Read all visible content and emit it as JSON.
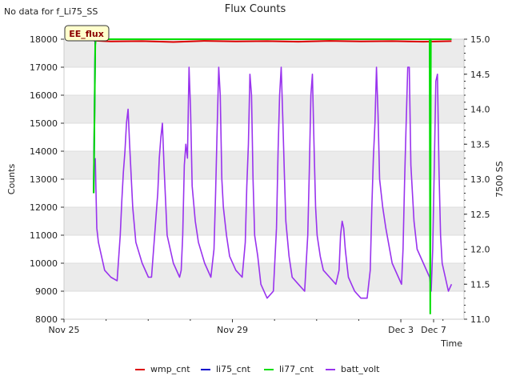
{
  "header": {
    "no_data_note": "No data for f_Li75_SS",
    "title": "Flux Counts",
    "badge": "EE_flux"
  },
  "colors": {
    "wmp_cnt": "#dd0000",
    "li75_cnt": "#0000cc",
    "li77_cnt": "#00dd00",
    "batt_volt": "#9933ee",
    "band": "#ebebeb",
    "badge_bg": "#ffffcc",
    "badge_text": "#8b0000"
  },
  "chart_data": {
    "type": "line",
    "title": "Flux Counts",
    "xlabel": "Time",
    "ylabel": "Counts",
    "y2label": "7500 SS",
    "xlim": [
      0,
      9.5
    ],
    "ylim": [
      8000,
      18000
    ],
    "y2lim": [
      11.0,
      15.0
    ],
    "x_ticks": [
      {
        "x": 0,
        "label": "Nov 25"
      },
      {
        "x": 4,
        "label": "Nov 29"
      },
      {
        "x": 8,
        "label": "Dec 3"
      },
      {
        "x": 12,
        "label": "Dec 7"
      }
    ],
    "y_ticks": [
      8000,
      9000,
      10000,
      11000,
      12000,
      13000,
      14000,
      15000,
      16000,
      17000,
      18000
    ],
    "y2_ticks": [
      "11.0",
      "11.5",
      "12.0",
      "12.5",
      "13.0",
      "13.5",
      "14.0",
      "14.5",
      "15.0"
    ],
    "grid": true,
    "legend_position": "bottom",
    "series": [
      {
        "name": "wmp_cnt",
        "axis": "left",
        "x": [
          0.95,
          1.5,
          2.5,
          3.5,
          4.5,
          5.5,
          6.5,
          7.5,
          8.5,
          9.5,
          10.5,
          11.5,
          12.4
        ],
        "y": [
          17950,
          17920,
          17930,
          17900,
          17940,
          17920,
          17930,
          17910,
          17940,
          17920,
          17930,
          17910,
          17930
        ]
      },
      {
        "name": "li75_cnt",
        "axis": "left",
        "x": [
          0.95,
          1.0,
          12.4
        ],
        "y": [
          12500,
          18000,
          18000
        ]
      },
      {
        "name": "li77_cnt",
        "axis": "left",
        "x": [
          0.95,
          1.0,
          1.02,
          11.7,
          11.72,
          11.74,
          11.76,
          12.4
        ],
        "y": [
          12500,
          17800,
          18000,
          18000,
          8200,
          18000,
          18000,
          18000
        ]
      },
      {
        "name": "batt_volt",
        "axis": "right",
        "x": [
          1.0,
          1.05,
          1.1,
          1.2,
          1.3,
          1.5,
          1.7,
          1.8,
          1.85,
          1.9,
          1.95,
          2.0,
          2.05,
          2.1,
          2.2,
          2.3,
          2.5,
          2.7,
          2.8,
          2.9,
          3.0,
          3.05,
          3.1,
          3.15,
          3.2,
          3.3,
          3.5,
          3.7,
          3.75,
          3.8,
          3.85,
          3.9,
          3.95,
          4.0,
          4.05,
          4.1,
          4.2,
          4.3,
          4.5,
          4.7,
          4.8,
          4.85,
          4.9,
          4.95,
          5.0,
          5.05,
          5.1,
          5.2,
          5.3,
          5.5,
          5.7,
          5.8,
          5.85,
          5.9,
          5.95,
          6.0,
          6.05,
          6.1,
          6.2,
          6.3,
          6.5,
          6.7,
          6.8,
          6.85,
          6.9,
          6.95,
          7.0,
          7.05,
          7.1,
          7.2,
          7.3,
          7.5,
          7.7,
          7.8,
          7.85,
          7.9,
          7.95,
          8.0,
          8.05,
          8.1,
          8.2,
          8.3,
          8.5,
          8.7,
          8.8,
          8.85,
          8.9,
          8.95,
          9.0,
          9.05,
          9.1,
          9.2,
          9.3,
          9.5,
          9.7,
          9.8,
          9.85,
          9.9,
          9.95,
          10.0,
          10.05,
          10.1,
          10.2,
          10.3,
          10.5,
          10.7,
          10.8,
          10.85,
          10.9,
          10.95,
          11.0,
          11.05,
          11.1,
          11.2,
          11.3,
          11.5,
          11.7,
          11.75,
          11.8,
          11.85,
          11.9,
          11.95,
          12.0,
          12.05,
          12.1,
          12.2,
          12.3,
          12.4
        ],
        "y": [
          13.3,
          12.3,
          12.1,
          11.9,
          11.7,
          11.6,
          11.55,
          12.2,
          12.7,
          13.1,
          13.4,
          13.8,
          14.0,
          13.5,
          12.6,
          12.1,
          11.8,
          11.6,
          11.6,
          12.2,
          12.8,
          13.3,
          13.6,
          13.8,
          13.2,
          12.2,
          11.8,
          11.6,
          11.7,
          12.2,
          13.2,
          13.5,
          13.3,
          14.6,
          14.0,
          12.9,
          12.4,
          12.1,
          11.8,
          11.6,
          12.0,
          12.8,
          13.7,
          14.6,
          14.2,
          13.0,
          12.6,
          12.2,
          11.9,
          11.7,
          11.6,
          12.1,
          12.9,
          13.5,
          14.5,
          14.2,
          13.0,
          12.2,
          11.9,
          11.5,
          11.3,
          11.4,
          12.3,
          13.4,
          14.2,
          14.6,
          13.9,
          13.1,
          12.4,
          11.9,
          11.6,
          11.5,
          11.4,
          12.2,
          13.1,
          14.2,
          14.5,
          13.5,
          12.6,
          12.2,
          11.9,
          11.7,
          11.6,
          11.5,
          11.7,
          12.2,
          12.4,
          12.3,
          12.0,
          11.8,
          11.6,
          11.5,
          11.4,
          11.3,
          11.3,
          11.7,
          12.6,
          13.3,
          13.8,
          14.6,
          13.9,
          13.0,
          12.6,
          12.3,
          11.8,
          11.6,
          11.5,
          12.0,
          13.0,
          13.8,
          14.6,
          14.6,
          13.2,
          12.4,
          12.0,
          11.8,
          11.6,
          11.4,
          12.0,
          13.2,
          14.4,
          14.5,
          13.1,
          12.2,
          11.8,
          11.6,
          11.4,
          11.5
        ]
      }
    ]
  },
  "legend": {
    "items": [
      "wmp_cnt",
      "li75_cnt",
      "li77_cnt",
      "batt_volt"
    ]
  }
}
